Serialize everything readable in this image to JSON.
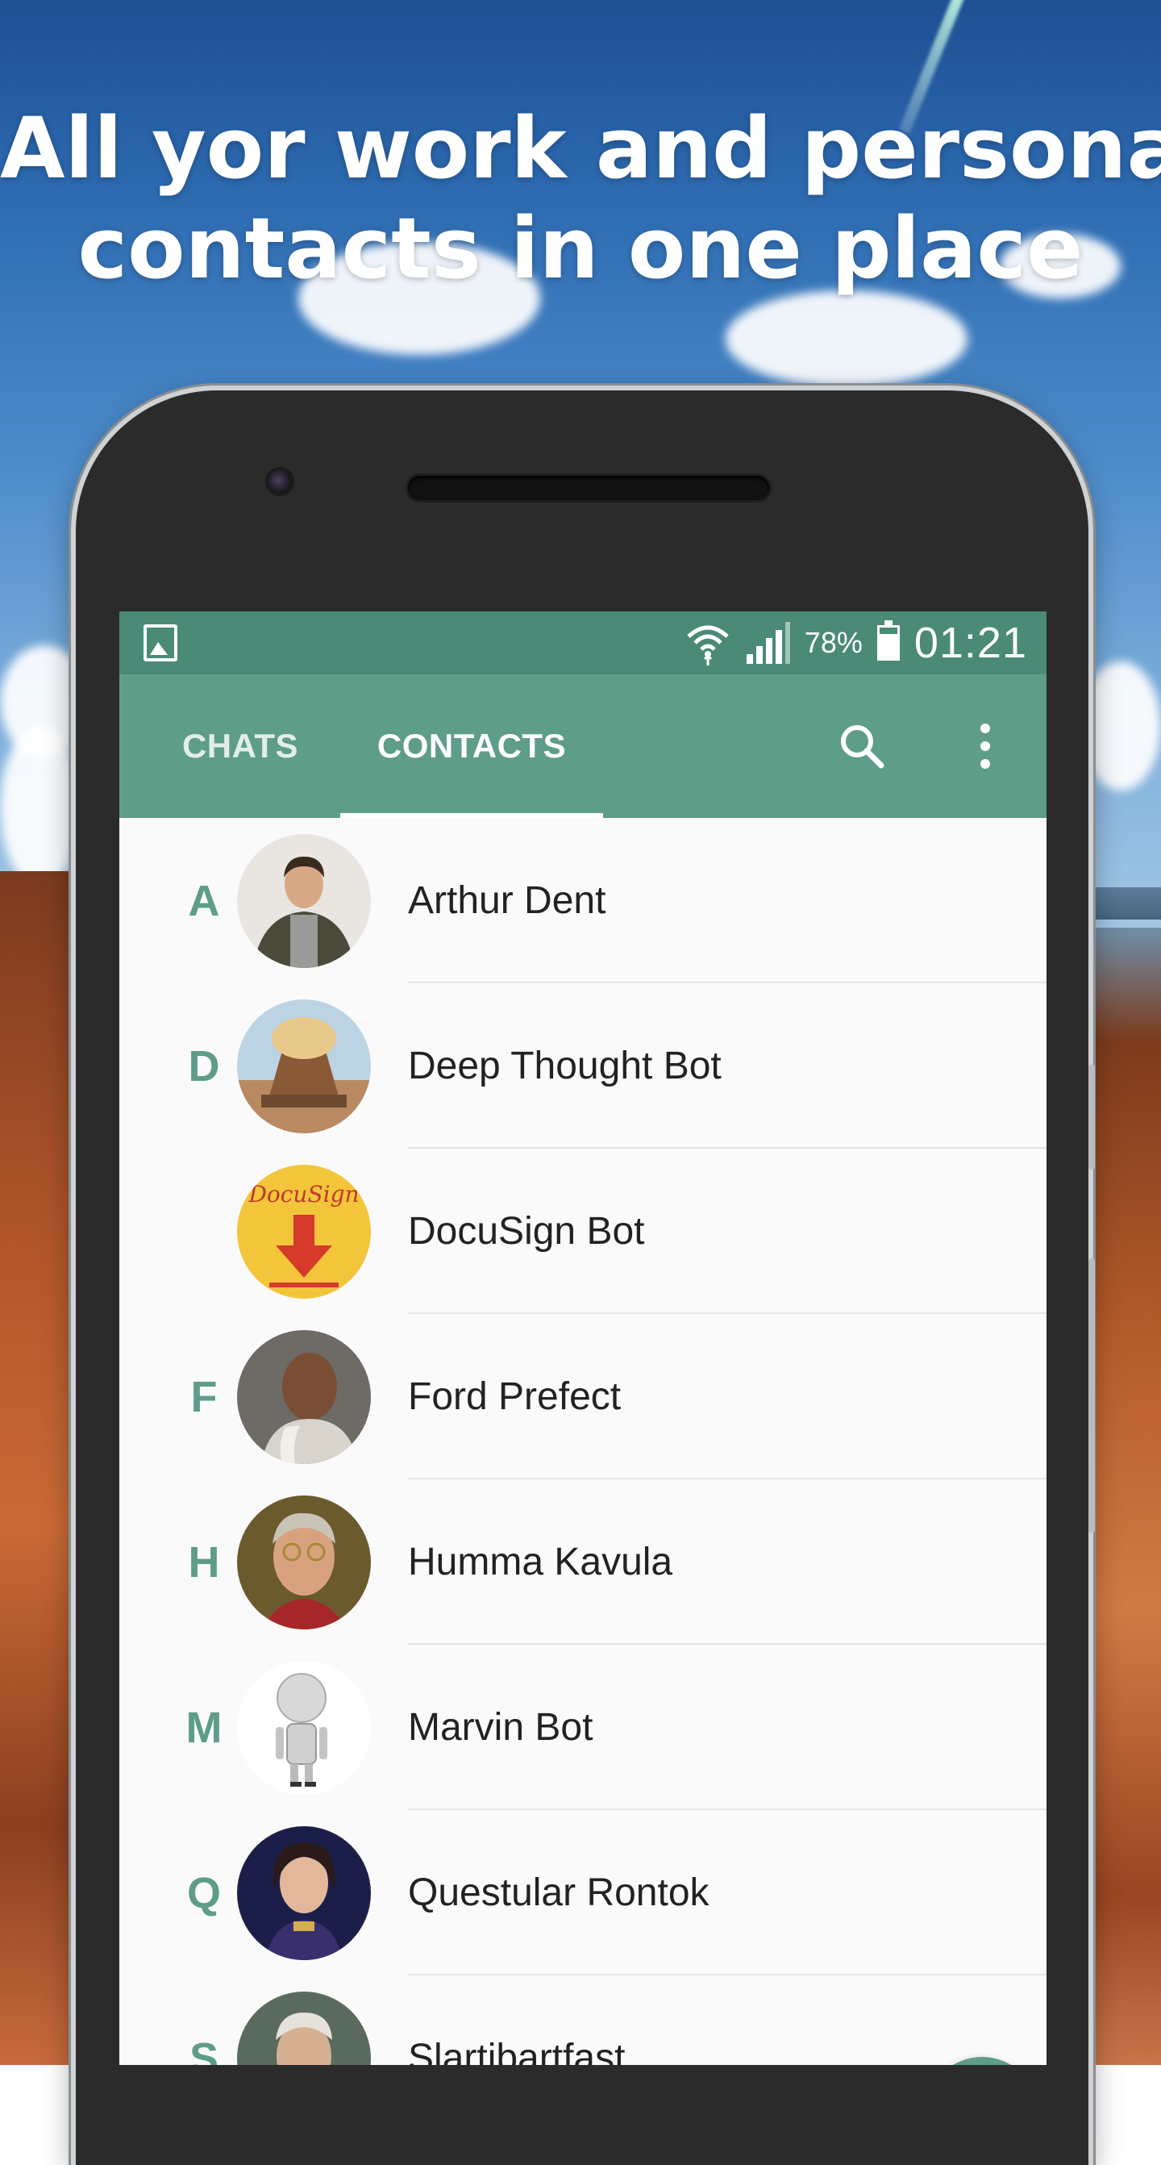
{
  "headline": {
    "line1": "All yor work and personal",
    "line2": "contacts in one place"
  },
  "status_bar": {
    "battery": "78%",
    "battery_level": 0.78,
    "time": "01:21",
    "icons": [
      "gallery-icon",
      "wifi-icon",
      "signal-icon",
      "battery-icon"
    ]
  },
  "app_bar": {
    "tabs": [
      {
        "label": "CHATS",
        "selected": false
      },
      {
        "label": "CONTACTS",
        "selected": true
      }
    ],
    "actions": [
      "search-icon",
      "more-vert-icon"
    ]
  },
  "contacts": [
    {
      "letter": "A",
      "name": "Arthur Dent"
    },
    {
      "letter": "D",
      "name": "Deep Thought Bot"
    },
    {
      "letter": "",
      "name": "DocuSign Bot",
      "avatar_text": "DocuSign"
    },
    {
      "letter": "F",
      "name": "Ford Prefect"
    },
    {
      "letter": "H",
      "name": "Humma Kavula"
    },
    {
      "letter": "M",
      "name": "Marvin Bot"
    },
    {
      "letter": "Q",
      "name": "Questular Rontok"
    },
    {
      "letter": "S",
      "name": "Slartibartfast"
    }
  ],
  "colors": {
    "status_bar": "#4a8a76",
    "app_bar": "#5e9d88",
    "accent": "#5e9d88"
  }
}
